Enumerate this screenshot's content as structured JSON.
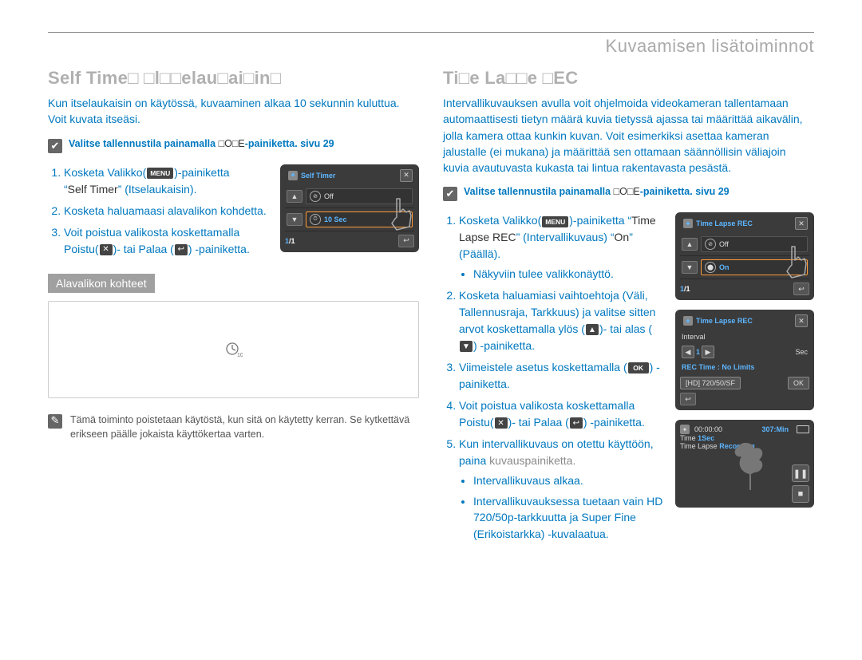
{
  "page": {
    "section_header": "Kuvaamisen lisätoiminnot",
    "page_number": ""
  },
  "left": {
    "heading": "Self Time□ □l□□elau□ai□in□",
    "intro": "Kun itselaukaisin on käytössä, kuvaaminen alkaa 10 sekunnin kuluttua. Voit kuvata itseäsi.",
    "mode_note_prefix": "Valitse tallennustila painamalla ",
    "mode_note_btn": "□O□E",
    "mode_note_suffix": "-painiketta. sivu 29",
    "step1_a": "Kosketa Valikko(",
    "step1_menu": "MENU",
    "step1_b": ")-painiketta",
    "step1_quote_a": "“",
    "step1_quote_mid": "Self Timer",
    "step1_quote_b": "” (Itselaukaisin).",
    "step2": "Kosketa haluamaasi alavalikon kohdetta.",
    "step3_a": "Voit poistua valikosta koskettamalla Poistu(",
    "step3_b": ")- tai Palaa (",
    "step3_c": ") -painiketta.",
    "subheader": "Alavalikon kohteet",
    "footnote": "Tämä toiminto poistetaan käytöstä, kun sitä on käytetty kerran. Se kytkettävä erikseen päälle jokaista käyttökertaa varten.",
    "screen1": {
      "title": "Self Timer",
      "row1_label": "Off",
      "row2_label": "10 Sec",
      "pager_cur": "1",
      "pager_tot": "1"
    }
  },
  "right": {
    "heading": "Ti□e La□□e □EC",
    "intro": "Intervallikuvauksen avulla voit ohjelmoida videokameran tallentamaan automaattisesti tietyn määrä kuvia tietyssä ajassa tai määrittää aikavälin, jolla kamera ottaa kunkin kuvan. Voit esimerkiksi asettaa kameran jalustalle (ei mukana) ja määrittää sen ottamaan säännöllisin väliajoin kuvia avautuvasta kukasta tai lintua rakentavasta pesästä.",
    "mode_note_prefix": "Valitse tallennustila painamalla ",
    "mode_note_btn": "□O□E",
    "mode_note_suffix": "-painiketta.  sivu 29",
    "step1_a": "Kosketa Valikko(",
    "step1_menu": "MENU",
    "step1_b": ")-painiketta  “",
    "step1_item": "Time Lapse REC",
    "step1_c": "” (Intervallikuvaus)  “",
    "step1_on": "On",
    "step1_d": "” (Päällä).",
    "step1_bullet": "Näkyviin tulee valikkonäyttö.",
    "step2_a": "Kosketa haluamiasi vaihtoehtoja (Väli, Tallennusraja, Tarkkuus) ja valitse sitten arvot koskettamalla ylös (",
    "step2_b": ")- tai alas (",
    "step2_c": ") -painiketta.",
    "step3_a": "Viimeistele asetus koskettamalla (",
    "step3_ok": "OK",
    "step3_b": ") -painiketta.",
    "step4_a": "Voit poistua valikosta koskettamalla Poistu(",
    "step4_b": ")- tai Palaa (",
    "step4_c": ") -painiketta.",
    "step5_a": "Kun intervallikuvaus on otettu käyttöön, paina ",
    "step5_link": "kuvauspainiketta.",
    "bullet1": "Intervallikuvaus alkaa.",
    "bullet2": "Intervallikuvauksessa tuetaan vain  HD 720/50p-tarkkuutta ja Super Fine (Erikoistarkka) -kuvalaatua.",
    "screenA": {
      "title": "Time Lapse REC",
      "row1_label": "Off",
      "row2_label": "On",
      "pager_cur": "1",
      "pager_tot": "1"
    },
    "screenB": {
      "title": "Time Lapse REC",
      "interval_label": "Interval",
      "interval_val": "1",
      "interval_unit": "Sec",
      "reclimit_label": "REC Time : No Limits",
      "res_label": "[HD] 720/50/SF",
      "back": "⟲",
      "ok": "OK"
    },
    "screenC": {
      "time": "00:00:00",
      "status": "307:Min",
      "res": "1Sec",
      "res_pre": "Time ",
      "tl_a": "Time Lapse",
      "tl_b": "Recording"
    }
  }
}
